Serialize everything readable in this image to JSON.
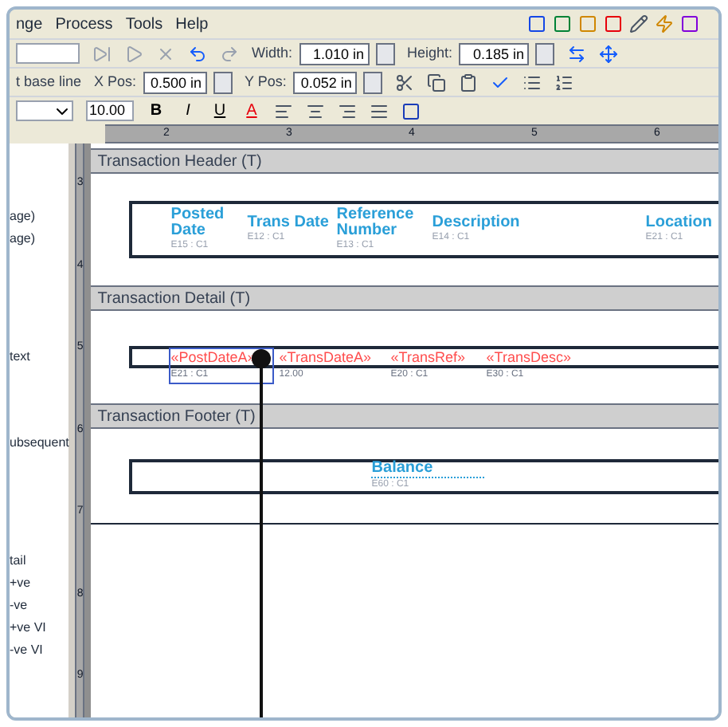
{
  "menu": [
    {
      "label": "nge"
    },
    {
      "label": "Process"
    },
    {
      "label": "Tools"
    },
    {
      "label": "Help"
    }
  ],
  "toolbar": {
    "width_label": "Width:",
    "width": "1.010 in",
    "height_label": "Height:",
    "height": "0.185 in",
    "baseline": "t base line",
    "xpos_label": "X Pos:",
    "xpos": "0.500 in",
    "ypos_label": "Y Pos:",
    "ypos": "0.052 in",
    "font_size": "10.00",
    "format_buttons": [
      "B",
      "I",
      "U",
      "A"
    ]
  },
  "ruler_numbers": [
    "2",
    "3",
    "4",
    "5",
    "6"
  ],
  "vruler_numbers": [
    "3",
    "4",
    "5",
    "6",
    "7",
    "8",
    "9"
  ],
  "left_panel": [
    "age)",
    "age)",
    "text",
    "ubsequent",
    "tail",
    "+ve",
    "-ve",
    "+ve VI",
    "-ve VI"
  ],
  "sections": [
    {
      "kind": "header",
      "title": "Transaction Header (T)",
      "fields": [
        {
          "text": "Posted Date",
          "ref": "E15 : C1"
        },
        {
          "text": "Trans Date",
          "ref": "E12 : C1"
        },
        {
          "text": "Reference Number",
          "ref": "E13 : C1"
        },
        {
          "text": "Description",
          "ref": "E14 : C1"
        },
        {
          "text": "Location",
          "ref": "E21 : C1"
        }
      ]
    },
    {
      "kind": "detail",
      "title": "Transaction Detail (T)",
      "fields": [
        {
          "text": "«PostDateA»",
          "ref": "E21 : C1",
          "selected": true
        },
        {
          "text": "«TransDateA»",
          "ref": "12.00",
          "selected": false
        },
        {
          "text": "«TransRef»",
          "ref": "E20 : C1",
          "selected": false
        },
        {
          "text": "«TransDesc»",
          "ref": "E30 : C1",
          "selected": false
        }
      ]
    },
    {
      "kind": "footer",
      "title": "Transaction Footer (T)",
      "fields": [
        {
          "text": "Balance",
          "ref": "E60 : C1"
        }
      ]
    }
  ]
}
